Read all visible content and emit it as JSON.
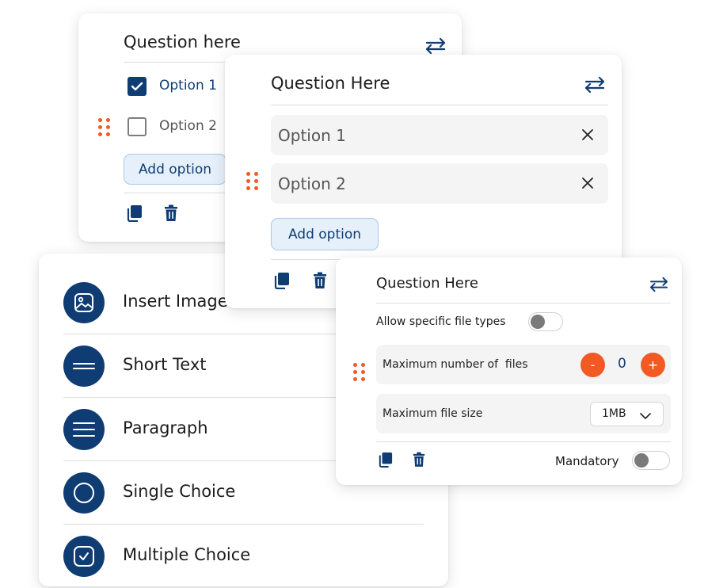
{
  "card1": {
    "title": "Question here",
    "options": [
      {
        "label": "Option 1",
        "checked": true
      },
      {
        "label": "Option 2",
        "checked": false
      }
    ],
    "add_option": "Add option"
  },
  "card2": {
    "title": "Question Here",
    "options": [
      "Option 1",
      "Option 2"
    ],
    "add_option": "Add option"
  },
  "card3": {
    "title": "Question Here",
    "allow_file_types": "Allow specific file types",
    "max_files_label": "Maximum number of  files",
    "max_files_value": "0",
    "minus": "-",
    "plus": "+",
    "max_size_label": "Maximum file size",
    "max_size_value": "1MB",
    "mandatory": "Mandatory"
  },
  "menu": {
    "items": [
      {
        "label": "Insert Image",
        "icon": "image-icon"
      },
      {
        "label": "Short Text",
        "icon": "short-text-icon"
      },
      {
        "label": "Paragraph",
        "icon": "paragraph-icon"
      },
      {
        "label": "Single Choice",
        "icon": "radio-icon"
      },
      {
        "label": "Multiple Choice",
        "icon": "checkbox-icon"
      }
    ]
  },
  "colors": {
    "navy": "#0f3d73",
    "accent": "#f15a22",
    "chip_bg": "#e6f0fb"
  }
}
